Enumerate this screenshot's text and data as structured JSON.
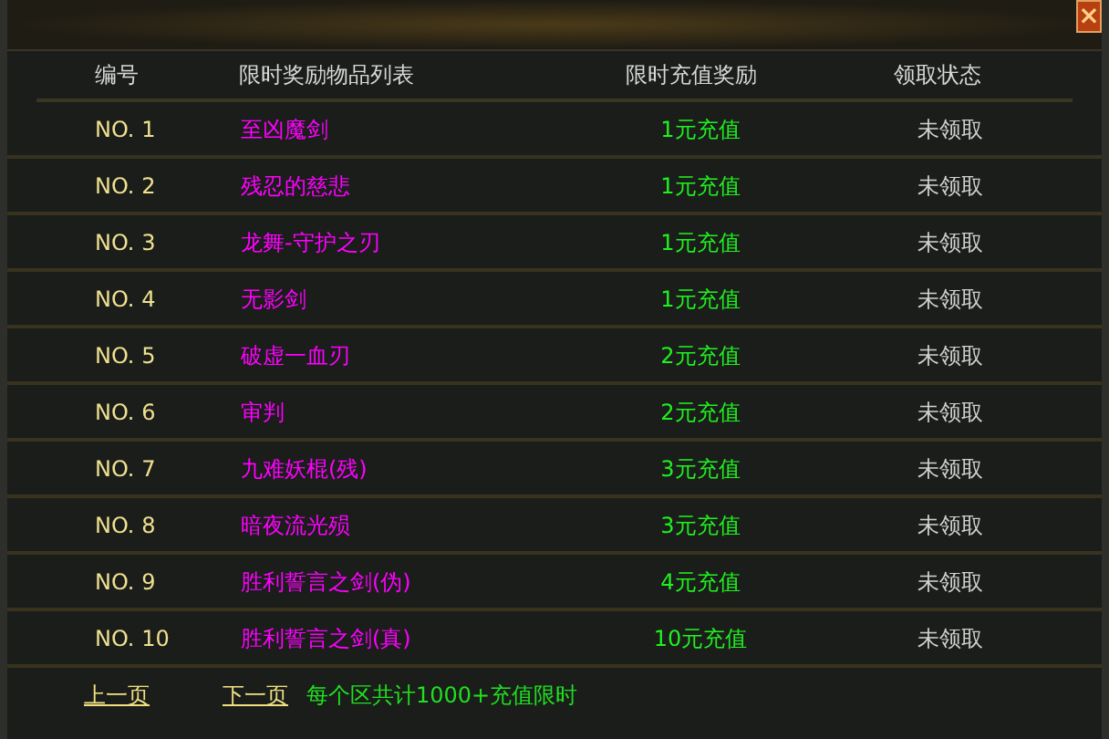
{
  "window": {
    "close": "×"
  },
  "table": {
    "columns": [
      "编号",
      "限时奖励物品列表",
      "限时充值奖励",
      "领取状态"
    ],
    "rows": [
      {
        "number": "NO. 1",
        "item": "至凶魔剑",
        "reward": "1元充值",
        "status": "未领取"
      },
      {
        "number": "NO. 2",
        "item": "残忍的慈悲",
        "reward": "1元充值",
        "status": "未领取"
      },
      {
        "number": "NO. 3",
        "item": "龙舞-守护之刃",
        "reward": "1元充值",
        "status": "未领取"
      },
      {
        "number": "NO. 4",
        "item": "无影剑",
        "reward": "1元充值",
        "status": "未领取"
      },
      {
        "number": "NO. 5",
        "item": "破虚一血刃",
        "reward": "2元充值",
        "status": "未领取"
      },
      {
        "number": "NO. 6",
        "item": "审判",
        "reward": "2元充值",
        "status": "未领取"
      },
      {
        "number": "NO. 7",
        "item": "九难妖棍(残)",
        "reward": "3元充值",
        "status": "未领取"
      },
      {
        "number": "NO. 8",
        "item": "暗夜流光殒",
        "reward": "3元充值",
        "status": "未领取"
      },
      {
        "number": "NO. 9",
        "item": "胜利誓言之剑(伪)",
        "reward": "4元充值",
        "status": "未领取"
      },
      {
        "number": "NO. 10",
        "item": "胜利誓言之剑(真)",
        "reward": "10元充值",
        "status": "未领取"
      }
    ]
  },
  "footer": {
    "prev": "上一页",
    "next": "下一页",
    "note": "每个区共计1000+充值限时"
  }
}
